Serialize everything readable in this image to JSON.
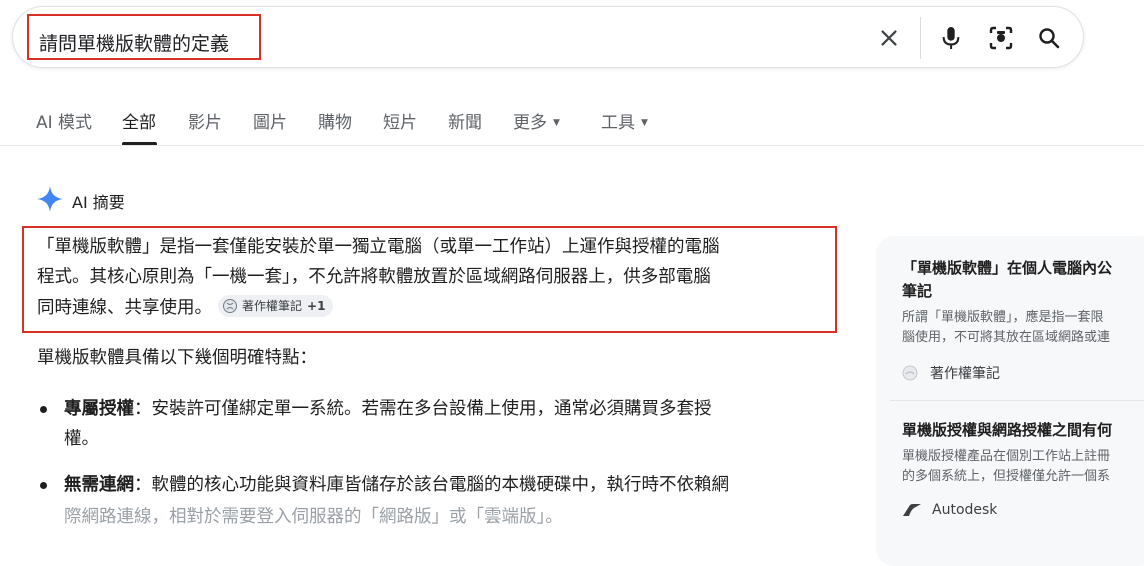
{
  "search": {
    "query": "請問單機版軟體的定義"
  },
  "tabs": [
    {
      "label": "AI 模式"
    },
    {
      "label": "全部"
    },
    {
      "label": "影片"
    },
    {
      "label": "圖片"
    },
    {
      "label": "購物"
    },
    {
      "label": "短片"
    },
    {
      "label": "新聞"
    },
    {
      "label": "更多"
    },
    {
      "label": "工具"
    }
  ],
  "ai_overview": {
    "title": "AI 摘要",
    "summary_lines": [
      "「單機版軟體」是指一套僅能安裝於單一獨立電腦（或單一工作站）上運作與授權的電腦",
      "程式。其核心原則為「一機一套」，不允許將軟體放置於區域網路伺服器上，供多部電腦",
      "同時連線、共享使用。"
    ],
    "citation": {
      "label": "著作權筆記",
      "extra": "+1"
    },
    "intro": "單機版軟體具備以下幾個明確特點：",
    "bullets": [
      {
        "term": "專屬授權",
        "lines": [
          "：安裝許可僅綁定單一系統。若需在多台設備上使用，通常必須購買多套授",
          "權。"
        ]
      },
      {
        "term": "無需連網",
        "lines": [
          "：軟體的核心功能與資料庫皆儲存於該台電腦的本機硬碟中，執行時不依賴網",
          "際網路連線，相對於需要登入伺服器的「網路版」或「雲端版」。"
        ]
      }
    ]
  },
  "side_cards": [
    {
      "title_lines": [
        "「單機版軟體」在個人電腦內公",
        "筆記"
      ],
      "snippet_lines": [
        "所謂「單機版軟體」，應是指一套限",
        "腦使用，不可將其放在區域網路或連"
      ],
      "source": "著作權筆記"
    },
    {
      "title_lines": [
        "單機版授權與網路授權之間有何"
      ],
      "snippet_lines": [
        "單機版授權產品在個別工作站上註冊",
        "的多個系統上，但授權僅允許一個系"
      ],
      "source": "Autodesk"
    }
  ],
  "colors": {
    "highlight_border": "#d93025",
    "ai_sparkle": "#4285f4"
  }
}
